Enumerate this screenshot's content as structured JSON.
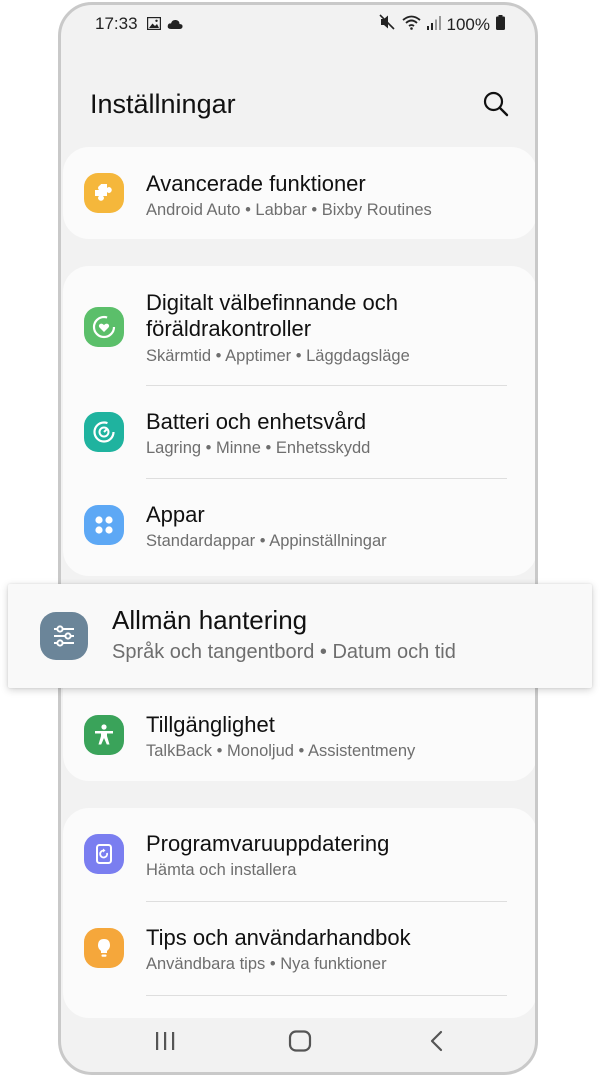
{
  "status_bar": {
    "time": "17:33",
    "battery": "100%",
    "left_icons": [
      "gallery-icon",
      "cloud-icon"
    ],
    "right_icons": [
      "mute-icon",
      "wifi-icon",
      "signal-icon",
      "battery-icon"
    ]
  },
  "header": {
    "title": "Inställningar",
    "search_icon": "search-icon"
  },
  "cards": [
    {
      "items": [
        {
          "title": "Avancerade funktioner",
          "subtitle": "Android Auto  •  Labbar  •  Bixby Routines",
          "icon": "puzzle-icon",
          "icon_color": "#f5b73b"
        }
      ]
    },
    {
      "items": [
        {
          "title_line1": "Digitalt välbefinnande och",
          "title_line2": "föräldrakontroller",
          "subtitle": "Skärmtid  •  Apptimer  •  Läggdagsläge",
          "icon": "wellbeing-icon",
          "icon_color": "#5bbf6a"
        },
        {
          "title": "Batteri och enhetsvård",
          "subtitle": "Lagring  •  Minne  •  Enhetsskydd",
          "icon": "device-care-icon",
          "icon_color": "#1fb39f"
        },
        {
          "title": "Appar",
          "subtitle": "Standardappar  •  Appinställningar",
          "icon": "apps-icon",
          "icon_color": "#5da8f5"
        }
      ]
    },
    {
      "items": [
        {
          "title": "Tillgänglighet",
          "subtitle": "TalkBack  •  Monoljud  •  Assistentmeny",
          "icon": "accessibility-icon",
          "icon_color": "#3aa35a"
        }
      ]
    },
    {
      "items": [
        {
          "title": "Programvaruuppdatering",
          "subtitle": "Hämta och installera",
          "icon": "software-update-icon",
          "icon_color": "#7a7ef0"
        },
        {
          "title": "Tips och användarhandbok",
          "subtitle": "Användbara tips  •  Nya funktioner",
          "icon": "lightbulb-icon",
          "icon_color": "#f5a73b"
        }
      ]
    }
  ],
  "highlighted_item": {
    "title": "Allmän hantering",
    "subtitle": "Språk och tangentbord  •  Datum och tid",
    "icon": "sliders-icon",
    "icon_color": "#6b8599"
  },
  "nav_bar": {
    "buttons": [
      "recents-button",
      "home-button",
      "back-button"
    ]
  }
}
